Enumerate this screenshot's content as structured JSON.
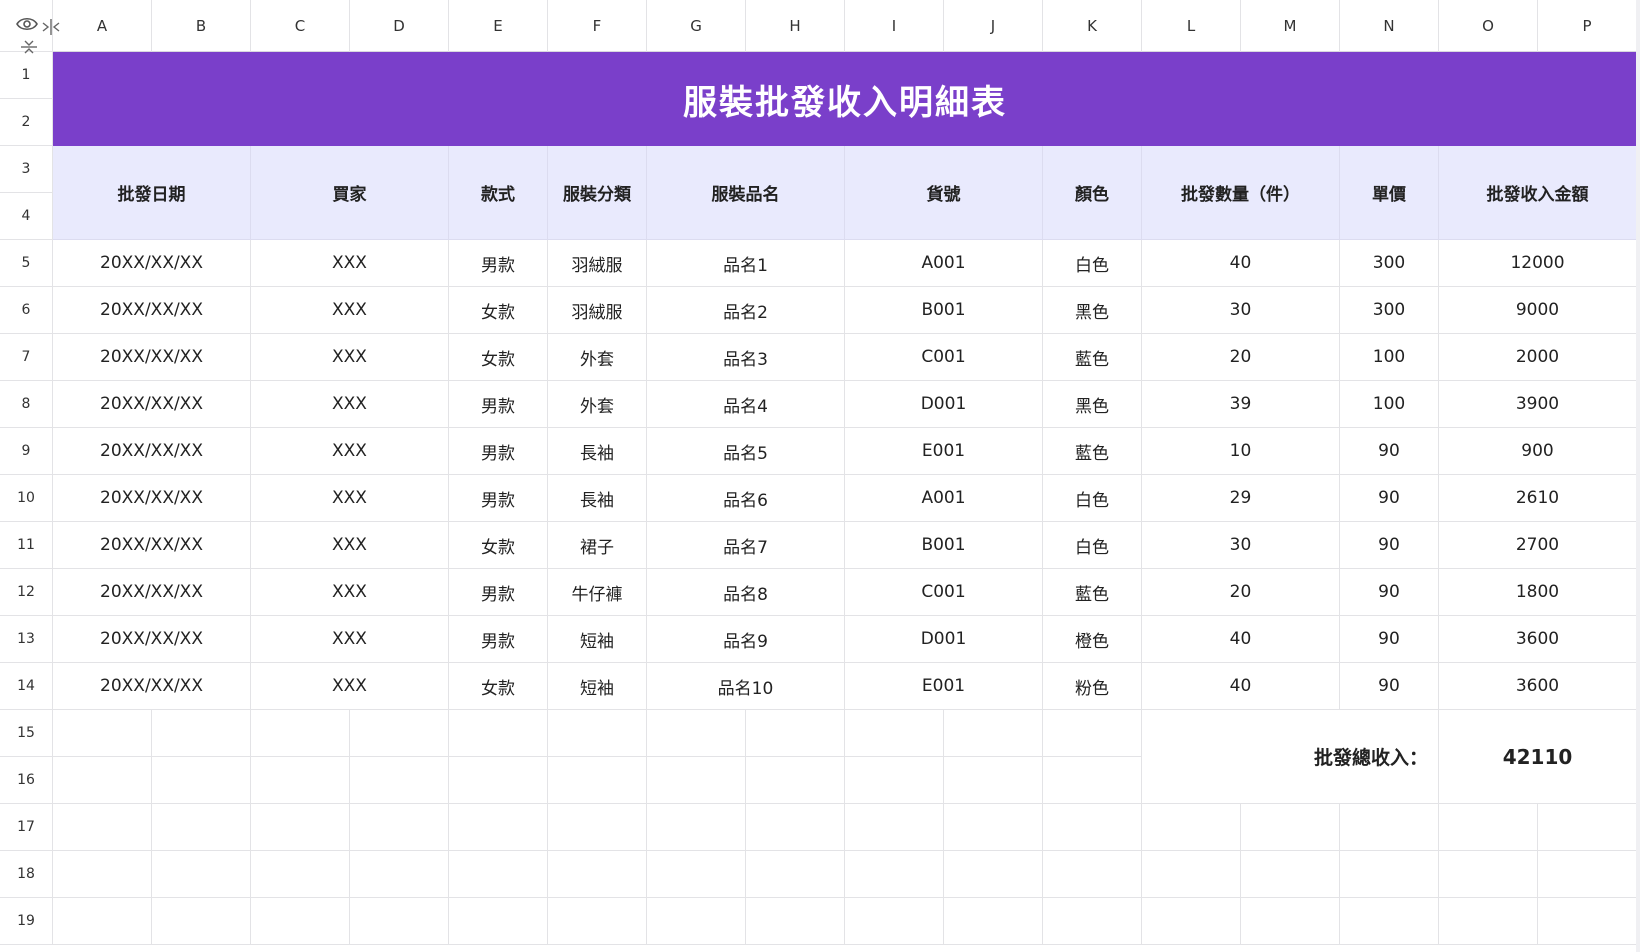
{
  "columns": [
    "A",
    "B",
    "C",
    "D",
    "E",
    "F",
    "G",
    "H",
    "I",
    "J",
    "K",
    "L",
    "M",
    "N",
    "O",
    "P"
  ],
  "rows": [
    "1",
    "2",
    "3",
    "4",
    "5",
    "6",
    "7",
    "8",
    "9",
    "10",
    "11",
    "12",
    "13",
    "14",
    "15",
    "16",
    "17",
    "18",
    "19"
  ],
  "title": "服裝批發收入明細表",
  "headers": {
    "date": "批發日期",
    "buyer": "買家",
    "style": "款式",
    "category": "服裝分類",
    "product": "服裝品名",
    "sku": "貨號",
    "color": "顏色",
    "qty": "批發數量（件）",
    "price": "單價",
    "amount": "批發收入金額"
  },
  "records": [
    {
      "date": "20XX/XX/XX",
      "buyer": "XXX",
      "style": "男款",
      "category": "羽絨服",
      "product": "品名1",
      "sku": "A001",
      "color": "白色",
      "qty": "40",
      "price": "300",
      "amount": "12000"
    },
    {
      "date": "20XX/XX/XX",
      "buyer": "XXX",
      "style": "女款",
      "category": "羽絨服",
      "product": "品名2",
      "sku": "B001",
      "color": "黑色",
      "qty": "30",
      "price": "300",
      "amount": "9000"
    },
    {
      "date": "20XX/XX/XX",
      "buyer": "XXX",
      "style": "女款",
      "category": "外套",
      "product": "品名3",
      "sku": "C001",
      "color": "藍色",
      "qty": "20",
      "price": "100",
      "amount": "2000"
    },
    {
      "date": "20XX/XX/XX",
      "buyer": "XXX",
      "style": "男款",
      "category": "外套",
      "product": "品名4",
      "sku": "D001",
      "color": "黑色",
      "qty": "39",
      "price": "100",
      "amount": "3900"
    },
    {
      "date": "20XX/XX/XX",
      "buyer": "XXX",
      "style": "男款",
      "category": "長袖",
      "product": "品名5",
      "sku": "E001",
      "color": "藍色",
      "qty": "10",
      "price": "90",
      "amount": "900"
    },
    {
      "date": "20XX/XX/XX",
      "buyer": "XXX",
      "style": "男款",
      "category": "長袖",
      "product": "品名6",
      "sku": "A001",
      "color": "白色",
      "qty": "29",
      "price": "90",
      "amount": "2610"
    },
    {
      "date": "20XX/XX/XX",
      "buyer": "XXX",
      "style": "女款",
      "category": "裙子",
      "product": "品名7",
      "sku": "B001",
      "color": "白色",
      "qty": "30",
      "price": "90",
      "amount": "2700"
    },
    {
      "date": "20XX/XX/XX",
      "buyer": "XXX",
      "style": "男款",
      "category": "牛仔褲",
      "product": "品名8",
      "sku": "C001",
      "color": "藍色",
      "qty": "20",
      "price": "90",
      "amount": "1800"
    },
    {
      "date": "20XX/XX/XX",
      "buyer": "XXX",
      "style": "男款",
      "category": "短袖",
      "product": "品名9",
      "sku": "D001",
      "color": "橙色",
      "qty": "40",
      "price": "90",
      "amount": "3600"
    },
    {
      "date": "20XX/XX/XX",
      "buyer": "XXX",
      "style": "女款",
      "category": "短袖",
      "product": "品名10",
      "sku": "E001",
      "color": "粉色",
      "qty": "40",
      "price": "90",
      "amount": "3600"
    }
  ],
  "total": {
    "label": "批發總收入：",
    "value": "42110"
  },
  "colors": {
    "title_bg": "#7a3fca",
    "header_bg": "#e9eafd",
    "gridline": "#e3e3e6"
  },
  "icons": {
    "corner": "eye-icon",
    "freeze_columns": "freeze-columns-icon",
    "freeze_rows": "freeze-rows-icon"
  }
}
